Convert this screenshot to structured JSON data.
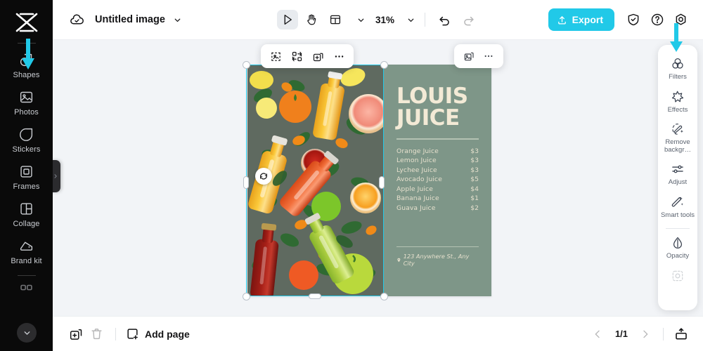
{
  "app": {
    "name": "CapCut Image Editor",
    "accent": "#21c9e8",
    "sidebar_bg": "#0a0a0a",
    "canvas_bg": "#f2f4f7"
  },
  "topbar": {
    "cloud_icon": "cloud-check-icon",
    "title": "Untitled image",
    "title_caret_icon": "chevron-down-icon",
    "tools": [
      {
        "name": "select-tool",
        "icon": "cursor-arrow-icon",
        "active": true
      },
      {
        "name": "hand-tool",
        "icon": "hand-icon",
        "active": false
      },
      {
        "name": "layout-tool",
        "icon": "layout-panel-icon",
        "active": false
      }
    ],
    "layout_caret_icon": "chevron-down-icon",
    "zoom_level": "31%",
    "zoom_caret_icon": "chevron-down-icon",
    "undo_icon": "undo-arrow-icon",
    "redo_icon": "redo-arrow-icon",
    "export_label": "Export",
    "export_icon": "upload-icon",
    "shield_icon": "shield-check-icon",
    "help_icon": "question-circle-icon",
    "settings_icon": "gear-icon"
  },
  "sidebar": {
    "logo_icon": "capcut-logo-icon",
    "items": [
      {
        "label": "Shapes",
        "icon": "shapes-icon",
        "lines": 1
      },
      {
        "label": "Photos",
        "icon": "photo-icon",
        "lines": 1
      },
      {
        "label": "Stickers",
        "icon": "sticker-icon",
        "lines": 1
      },
      {
        "label": "Frames",
        "icon": "frame-icon",
        "lines": 1
      },
      {
        "label": "Collage",
        "icon": "collage-icon",
        "lines": 1
      },
      {
        "label": "Brand kit",
        "icon": "brand-kit-icon",
        "lines": 2
      }
    ],
    "collapse_icon": "chevron-down-icon",
    "panel_peek_icon": "chevron-right-icon"
  },
  "annotations": {
    "arrow_color": "#21c9e8",
    "arrow_on_sidebar_target": "Shapes",
    "arrow_on_panel_target": "Filters"
  },
  "element_toolbar": {
    "buttons": [
      {
        "name": "cutout-button",
        "icon": "cutout-dashed-icon"
      },
      {
        "name": "replace-button",
        "icon": "swap-replace-icon"
      },
      {
        "name": "duplicate-button",
        "icon": "duplicate-plus-icon"
      },
      {
        "name": "more-options-button",
        "icon": "ellipsis-icon"
      }
    ]
  },
  "page_toolbar": {
    "buttons": [
      {
        "name": "duplicate-page-button",
        "icon": "duplicate-image-icon"
      },
      {
        "name": "page-more-button",
        "icon": "ellipsis-icon"
      }
    ]
  },
  "right_panel": {
    "items": [
      {
        "label": "Filters",
        "icon": "filters-circles-icon",
        "disabled": false
      },
      {
        "label": "Effects",
        "icon": "effects-star-icon",
        "disabled": false
      },
      {
        "label": "Remove backgr…",
        "icon": "remove-background-icon",
        "disabled": false
      },
      {
        "label": "Adjust",
        "icon": "adjust-sliders-icon",
        "disabled": false
      },
      {
        "label": "Smart tools",
        "icon": "smart-tools-wand-icon",
        "disabled": false
      }
    ],
    "opacity": {
      "label": "Opacity",
      "icon": "opacity-droplet-icon"
    },
    "locked_item": {
      "label": "",
      "icon": "crop-dashed-icon",
      "disabled": true
    }
  },
  "canvas": {
    "selection": {
      "visible": true,
      "rotate_icon": "rotate-handle-icon"
    },
    "artboard": {
      "background": "#7e9688",
      "photo": {
        "alt": "juice-bottles-and-fruit-photo",
        "description": "Top-down photo of colorful juice bottles among citrus fruit and leaves"
      },
      "poster": {
        "title_line_1": "LOUIS",
        "title_line_2": "JUICE",
        "title_color": "#f3ead6",
        "menu": [
          {
            "name": "Orange Juice",
            "price": "$3"
          },
          {
            "name": "Lemon Juice",
            "price": "$3"
          },
          {
            "name": "Lychee Juice",
            "price": "$3"
          },
          {
            "name": "Avocado Juice",
            "price": "$5"
          },
          {
            "name": "Apple Juice",
            "price": "$4"
          },
          {
            "name": "Banana Juice",
            "price": "$1"
          },
          {
            "name": "Guava Juice",
            "price": "$2"
          }
        ],
        "address": "123 Anywhere St., Any City",
        "address_icon": "map-pin-icon"
      }
    }
  },
  "bottombar": {
    "duplicate_icon": "duplicate-page-icon",
    "delete_icon": "trash-icon",
    "add_page_label": "Add page",
    "add_page_icon": "add-page-icon",
    "prev_icon": "chevron-left-icon",
    "next_icon": "chevron-right-icon",
    "page_indicator": "1/1",
    "present_icon": "present-icon"
  }
}
